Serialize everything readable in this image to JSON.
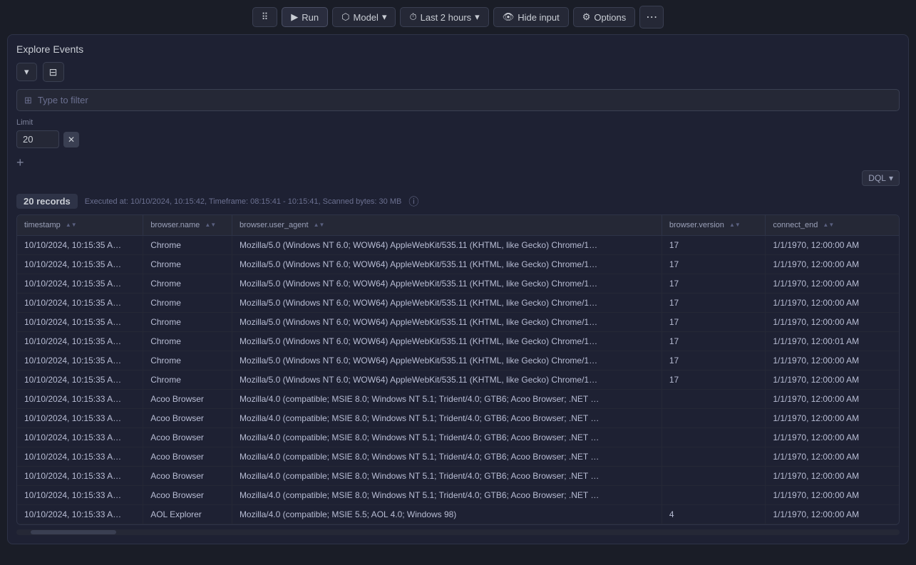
{
  "toolbar": {
    "run_label": "Run",
    "model_label": "Model",
    "timeframe_label": "Last 2 hours",
    "hide_input_label": "Hide input",
    "options_label": "Options",
    "more_icon": "⋯"
  },
  "panel": {
    "title": "Explore Events"
  },
  "filter": {
    "dropdown_label": "▾",
    "placeholder": "Type to filter",
    "filter_icon": "⊟"
  },
  "limit": {
    "label": "Limit",
    "value": "20"
  },
  "dql": {
    "label": "DQL",
    "chevron": "▾"
  },
  "records_bar": {
    "count": "20 records",
    "meta": "Executed at: 10/10/2024, 10:15:42, Timeframe: 08:15:41 - 10:15:41, Scanned bytes: 30 MB"
  },
  "table": {
    "columns": [
      {
        "key": "timestamp",
        "label": "timestamp"
      },
      {
        "key": "browser_name",
        "label": "browser.name"
      },
      {
        "key": "browser_user_agent",
        "label": "browser.user_agent"
      },
      {
        "key": "browser_version",
        "label": "browser.version"
      },
      {
        "key": "connect_end",
        "label": "connect_end"
      }
    ],
    "rows": [
      {
        "timestamp": "10/10/2024, 10:15:35 A…",
        "browser_name": "Chrome",
        "browser_user_agent": "Mozilla/5.0 (Windows NT 6.0; WOW64) AppleWebKit/535.11 (KHTML, like Gecko) Chrome/1…",
        "browser_version": "17",
        "connect_end": "1/1/1970, 12:00:00 AM"
      },
      {
        "timestamp": "10/10/2024, 10:15:35 A…",
        "browser_name": "Chrome",
        "browser_user_agent": "Mozilla/5.0 (Windows NT 6.0; WOW64) AppleWebKit/535.11 (KHTML, like Gecko) Chrome/1…",
        "browser_version": "17",
        "connect_end": "1/1/1970, 12:00:00 AM"
      },
      {
        "timestamp": "10/10/2024, 10:15:35 A…",
        "browser_name": "Chrome",
        "browser_user_agent": "Mozilla/5.0 (Windows NT 6.0; WOW64) AppleWebKit/535.11 (KHTML, like Gecko) Chrome/1…",
        "browser_version": "17",
        "connect_end": "1/1/1970, 12:00:00 AM"
      },
      {
        "timestamp": "10/10/2024, 10:15:35 A…",
        "browser_name": "Chrome",
        "browser_user_agent": "Mozilla/5.0 (Windows NT 6.0; WOW64) AppleWebKit/535.11 (KHTML, like Gecko) Chrome/1…",
        "browser_version": "17",
        "connect_end": "1/1/1970, 12:00:00 AM"
      },
      {
        "timestamp": "10/10/2024, 10:15:35 A…",
        "browser_name": "Chrome",
        "browser_user_agent": "Mozilla/5.0 (Windows NT 6.0; WOW64) AppleWebKit/535.11 (KHTML, like Gecko) Chrome/1…",
        "browser_version": "17",
        "connect_end": "1/1/1970, 12:00:00 AM"
      },
      {
        "timestamp": "10/10/2024, 10:15:35 A…",
        "browser_name": "Chrome",
        "browser_user_agent": "Mozilla/5.0 (Windows NT 6.0; WOW64) AppleWebKit/535.11 (KHTML, like Gecko) Chrome/1…",
        "browser_version": "17",
        "connect_end": "1/1/1970, 12:00:01 AM"
      },
      {
        "timestamp": "10/10/2024, 10:15:35 A…",
        "browser_name": "Chrome",
        "browser_user_agent": "Mozilla/5.0 (Windows NT 6.0; WOW64) AppleWebKit/535.11 (KHTML, like Gecko) Chrome/1…",
        "browser_version": "17",
        "connect_end": "1/1/1970, 12:00:00 AM"
      },
      {
        "timestamp": "10/10/2024, 10:15:35 A…",
        "browser_name": "Chrome",
        "browser_user_agent": "Mozilla/5.0 (Windows NT 6.0; WOW64) AppleWebKit/535.11 (KHTML, like Gecko) Chrome/1…",
        "browser_version": "17",
        "connect_end": "1/1/1970, 12:00:00 AM"
      },
      {
        "timestamp": "10/10/2024, 10:15:33 A…",
        "browser_name": "Acoo Browser",
        "browser_user_agent": "Mozilla/4.0 (compatible; MSIE 8.0; Windows NT 5.1; Trident/4.0; GTB6; Acoo Browser; .NET …",
        "browser_version": "",
        "connect_end": "1/1/1970, 12:00:00 AM"
      },
      {
        "timestamp": "10/10/2024, 10:15:33 A…",
        "browser_name": "Acoo Browser",
        "browser_user_agent": "Mozilla/4.0 (compatible; MSIE 8.0; Windows NT 5.1; Trident/4.0; GTB6; Acoo Browser; .NET …",
        "browser_version": "",
        "connect_end": "1/1/1970, 12:00:00 AM"
      },
      {
        "timestamp": "10/10/2024, 10:15:33 A…",
        "browser_name": "Acoo Browser",
        "browser_user_agent": "Mozilla/4.0 (compatible; MSIE 8.0; Windows NT 5.1; Trident/4.0; GTB6; Acoo Browser; .NET …",
        "browser_version": "",
        "connect_end": "1/1/1970, 12:00:00 AM"
      },
      {
        "timestamp": "10/10/2024, 10:15:33 A…",
        "browser_name": "Acoo Browser",
        "browser_user_agent": "Mozilla/4.0 (compatible; MSIE 8.0; Windows NT 5.1; Trident/4.0; GTB6; Acoo Browser; .NET …",
        "browser_version": "",
        "connect_end": "1/1/1970, 12:00:00 AM"
      },
      {
        "timestamp": "10/10/2024, 10:15:33 A…",
        "browser_name": "Acoo Browser",
        "browser_user_agent": "Mozilla/4.0 (compatible; MSIE 8.0; Windows NT 5.1; Trident/4.0; GTB6; Acoo Browser; .NET …",
        "browser_version": "",
        "connect_end": "1/1/1970, 12:00:00 AM"
      },
      {
        "timestamp": "10/10/2024, 10:15:33 A…",
        "browser_name": "Acoo Browser",
        "browser_user_agent": "Mozilla/4.0 (compatible; MSIE 8.0; Windows NT 5.1; Trident/4.0; GTB6; Acoo Browser; .NET …",
        "browser_version": "",
        "connect_end": "1/1/1970, 12:00:00 AM"
      },
      {
        "timestamp": "10/10/2024, 10:15:33 A…",
        "browser_name": "AOL Explorer",
        "browser_user_agent": "Mozilla/4.0 (compatible; MSIE 5.5; AOL 4.0; Windows 98)",
        "browser_version": "4",
        "connect_end": "1/1/1970, 12:00:00 AM"
      }
    ]
  },
  "colors": {
    "bg_dark": "#1a1d27",
    "bg_panel": "#1e2133",
    "bg_item": "#252836",
    "border": "#2e3347",
    "accent_blue": "#4a9eff",
    "text_primary": "#c9cdd4",
    "text_secondary": "#9aa0b8",
    "text_dim": "#6b7090"
  }
}
